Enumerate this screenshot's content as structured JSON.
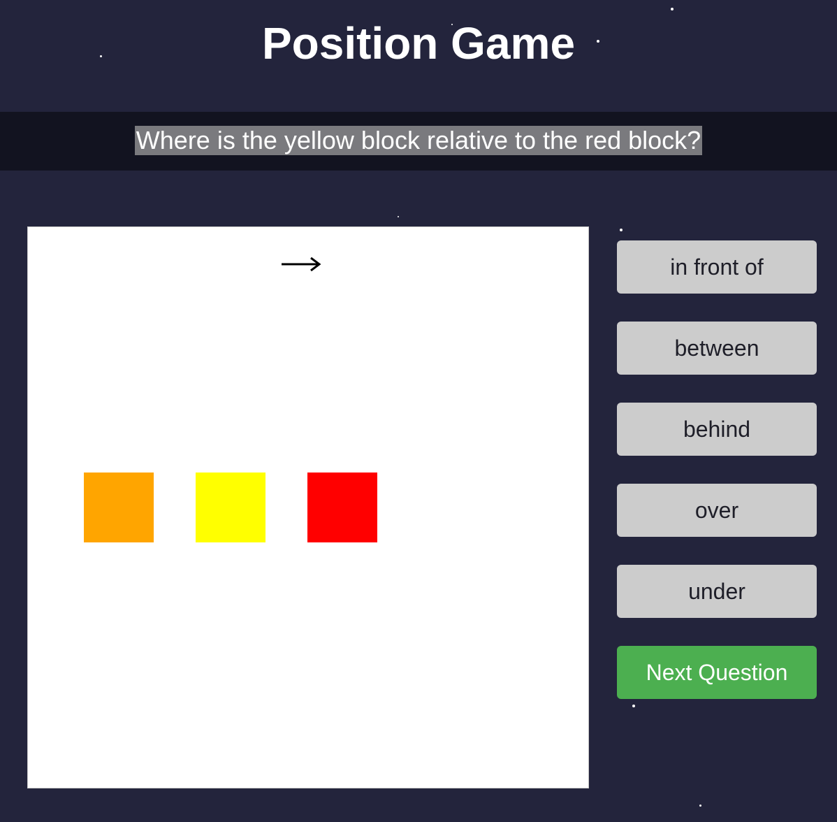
{
  "header": {
    "title": "Position Game"
  },
  "question": {
    "text": "Where is the yellow block relative to the red block?"
  },
  "scene": {
    "direction_arrow": "→",
    "blocks": [
      {
        "name": "orange-block",
        "color": "#ffa500"
      },
      {
        "name": "yellow-block",
        "color": "#ffff00"
      },
      {
        "name": "red-block",
        "color": "#ff0000"
      }
    ]
  },
  "answers": [
    {
      "label": "in front of"
    },
    {
      "label": "between"
    },
    {
      "label": "behind"
    },
    {
      "label": "over"
    },
    {
      "label": "under"
    }
  ],
  "controls": {
    "next_label": "Next Question"
  },
  "colors": {
    "background": "#23243c",
    "question_bar": "#121320",
    "question_highlight": "#7a7a7e",
    "answer_button": "#cccccc",
    "next_button": "#4caf50"
  }
}
